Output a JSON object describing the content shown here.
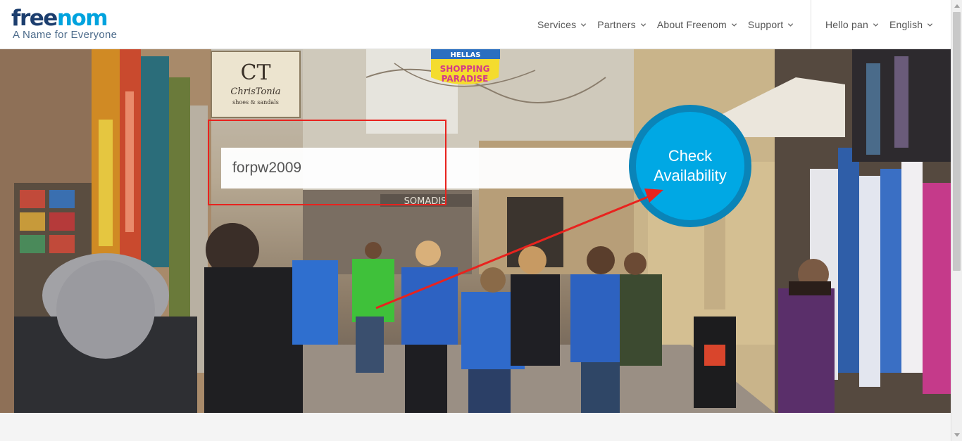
{
  "logo": {
    "word_a": "free",
    "word_b": "nom",
    "tagline": "A Name for Everyone"
  },
  "nav": {
    "main": [
      {
        "label": "Services"
      },
      {
        "label": "Partners"
      },
      {
        "label": "About Freenom"
      },
      {
        "label": "Support"
      }
    ],
    "user": [
      {
        "label": "Hello pan"
      },
      {
        "label": "English"
      }
    ]
  },
  "hero": {
    "search_value": "forpw2009",
    "check_button": {
      "line1": "Check",
      "line2": "Availability"
    },
    "signs": {
      "shop_big": "CT",
      "shop_name": "ChrisTonia",
      "shop_sub": "shoes & sandals",
      "banner_top": "HELLAS",
      "banner_line1": "SHOPPING",
      "banner_line2": "PARADISE",
      "store_sign": "SOMADIS"
    }
  },
  "colors": {
    "brand_dark": "#1c3e6e",
    "brand_accent": "#00a3de",
    "button_fill": "#00a8e4",
    "button_ring": "#0a84b8",
    "annotation": "#e8231e"
  },
  "icons": {
    "chevron": "chevron-down-icon"
  }
}
